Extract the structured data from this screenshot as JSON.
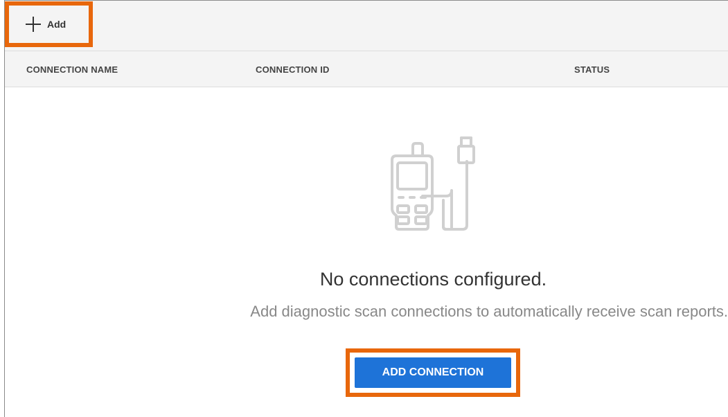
{
  "toolbar": {
    "add_label": "Add"
  },
  "table": {
    "columns": [
      "CONNECTION NAME",
      "CONNECTION ID",
      "STATUS"
    ]
  },
  "empty_state": {
    "icon": "scan-tool-icon",
    "title": "No connections configured.",
    "subtitle": "Add diagnostic scan connections to automatically receive scan reports.",
    "button_label": "ADD CONNECTION"
  },
  "colors": {
    "highlight": "#e8670c",
    "primary_button": "#1e73d8",
    "toolbar_bg": "#f4f4f4",
    "icon_gray": "#d0d0d0"
  }
}
